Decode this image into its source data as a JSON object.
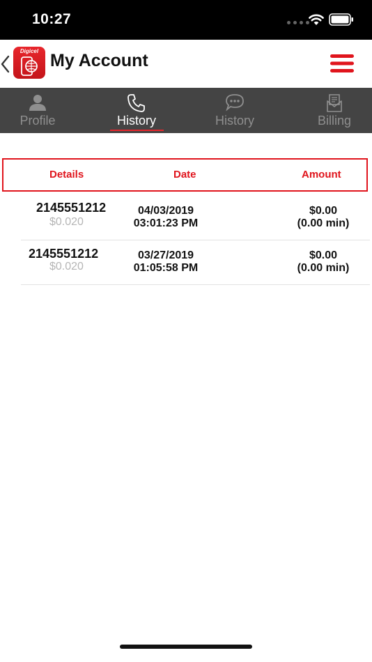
{
  "status_bar": {
    "time": "10:27"
  },
  "header": {
    "logo_text": "Digicel",
    "title": "My Account"
  },
  "tabs": [
    {
      "label": "Profile",
      "icon": "person-icon",
      "active": false
    },
    {
      "label": "History",
      "icon": "phone-icon",
      "active": true
    },
    {
      "label": "History",
      "icon": "chat-bubble-icon",
      "active": false
    },
    {
      "label": "Billing",
      "icon": "billing-envelope-icon",
      "active": false
    }
  ],
  "table": {
    "columns": [
      "Details",
      "Date",
      "Amount"
    ],
    "rows": [
      {
        "number": "2145551212",
        "rate": "$0.020",
        "date": "04/03/2019",
        "time": "03:01:23 PM",
        "amount": "$0.00",
        "duration": "(0.00 min)"
      },
      {
        "number": "2145551212",
        "rate": "$0.020",
        "date": "03/27/2019",
        "time": "01:05:58 PM",
        "amount": "$0.00",
        "duration": "(0.00 min)"
      }
    ]
  },
  "colors": {
    "accent": "#e0141c",
    "tab_bar": "#444444",
    "inactive_tab": "#8f8f8f"
  }
}
